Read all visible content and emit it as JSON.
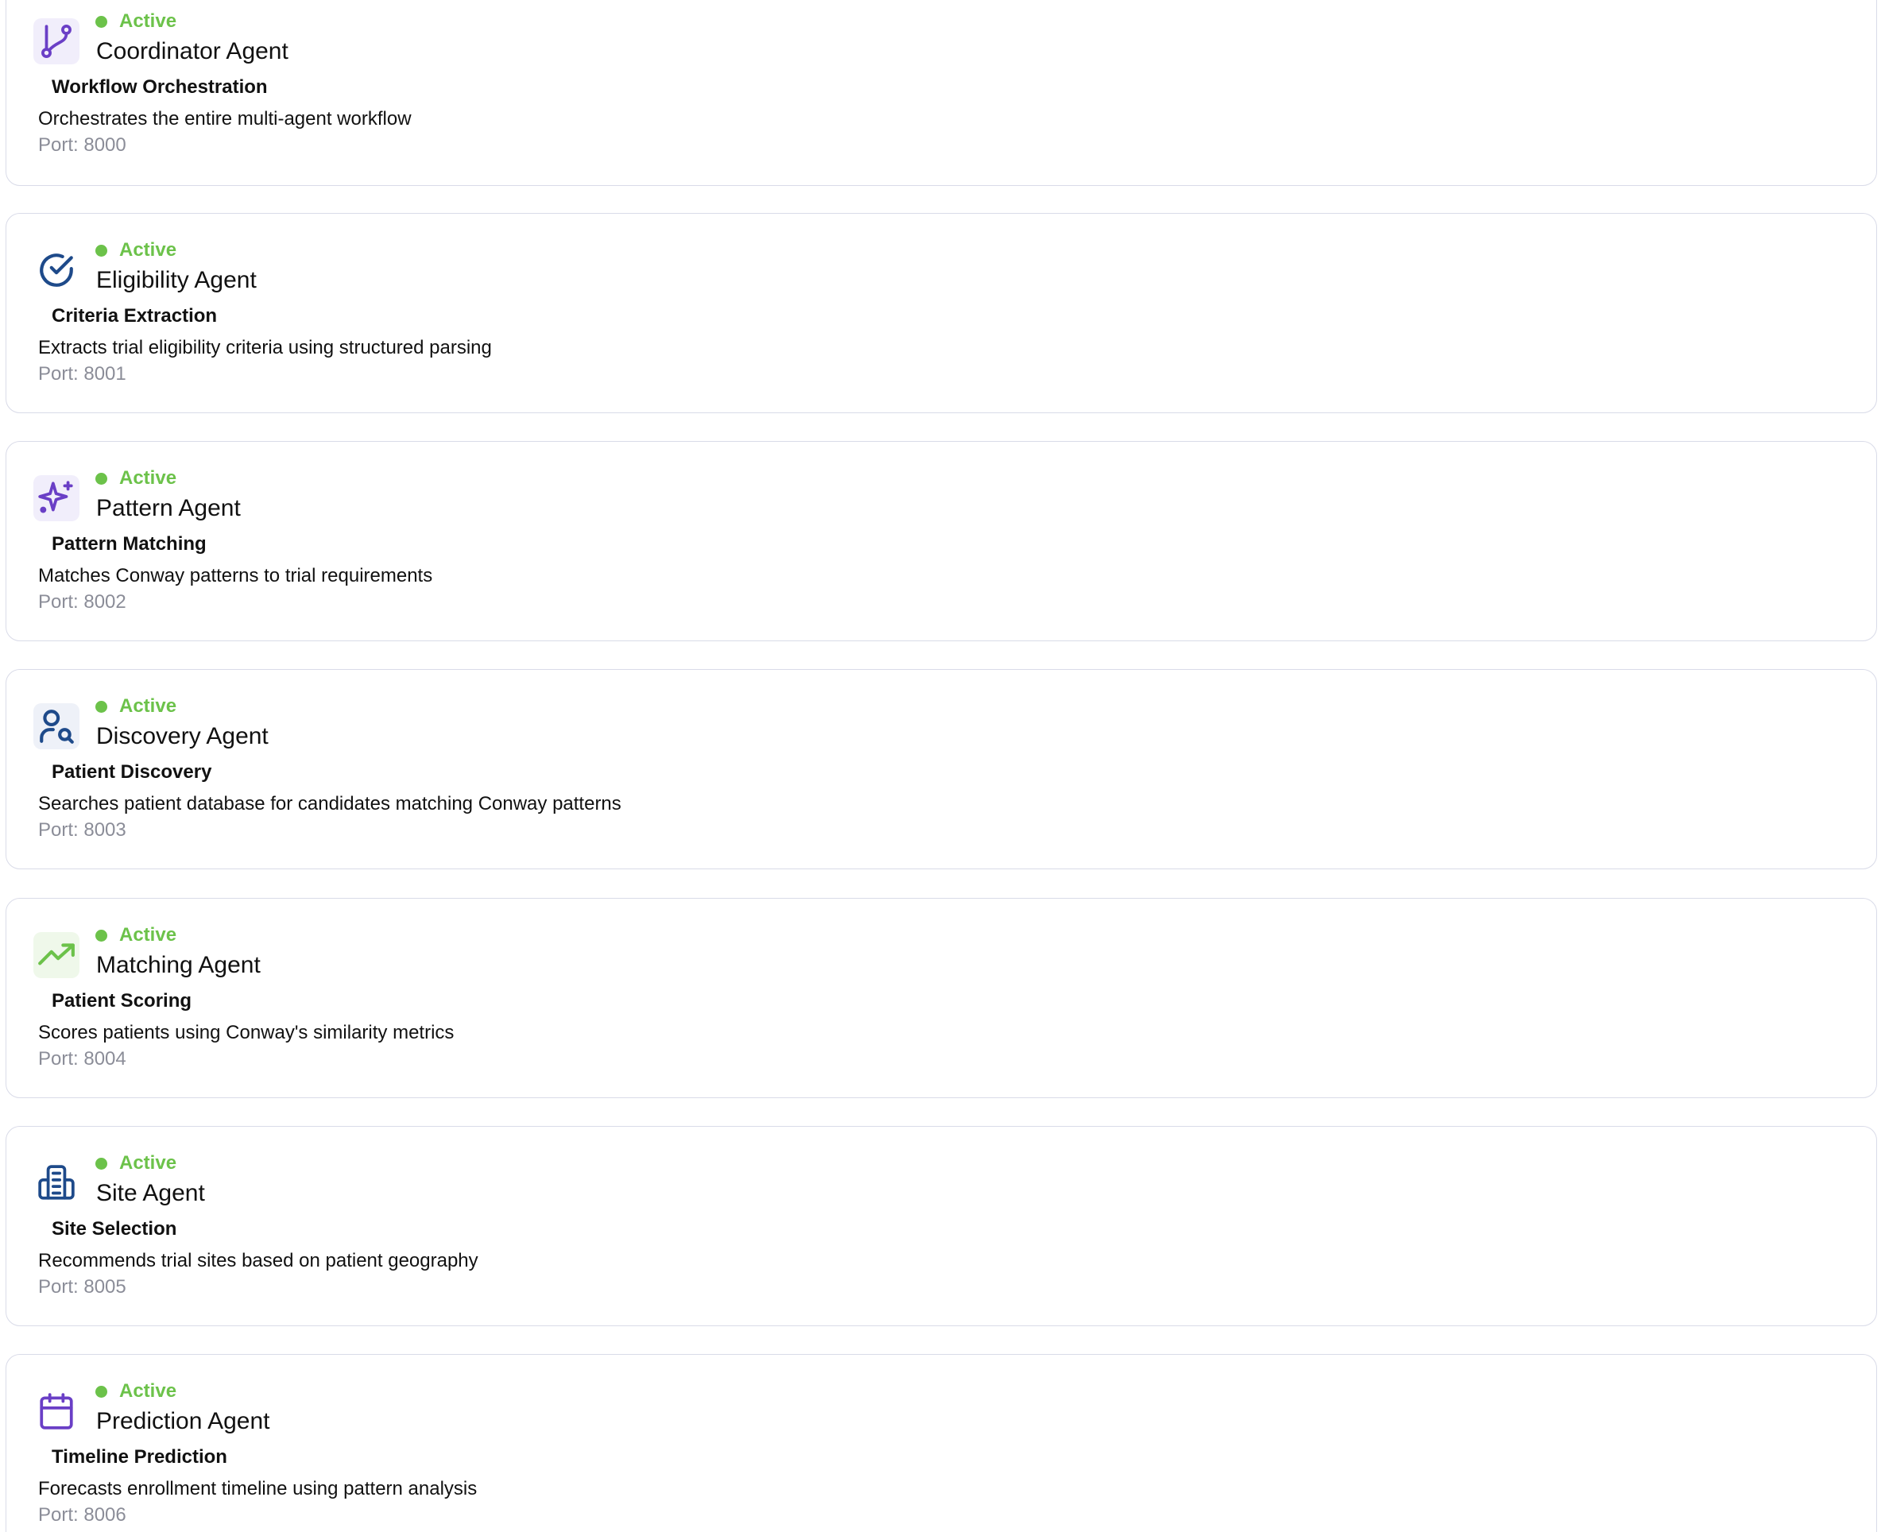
{
  "colors": {
    "status_active": "#6cc24a",
    "card_border": "#d9dbe8",
    "port_text": "#8b8d98",
    "icon_purple": "#6a3fc6",
    "icon_blue": "#1e4a8a",
    "icon_green": "#6cc24a"
  },
  "agents": [
    {
      "status": "Active",
      "name": "Coordinator Agent",
      "role": "Workflow Orchestration",
      "description": "Orchestrates the entire multi-agent workflow",
      "port": "Port: 8000",
      "icon": "git-branch-icon",
      "icon_color": "#6a3fc6",
      "icon_bg": "#f1eefb"
    },
    {
      "status": "Active",
      "name": "Eligibility Agent",
      "role": "Criteria Extraction",
      "description": "Extracts trial eligibility criteria using structured parsing",
      "port": "Port: 8001",
      "icon": "check-circle-icon",
      "icon_color": "#1e4a8a",
      "icon_bg": "#ffffff"
    },
    {
      "status": "Active",
      "name": "Pattern Agent",
      "role": "Pattern Matching",
      "description": "Matches Conway patterns to trial requirements",
      "port": "Port: 8002",
      "icon": "sparkles-icon",
      "icon_color": "#6a3fc6",
      "icon_bg": "#f1eefb"
    },
    {
      "status": "Active",
      "name": "Discovery Agent",
      "role": "Patient Discovery",
      "description": "Searches patient database for candidates matching Conway patterns",
      "port": "Port: 8003",
      "icon": "user-search-icon",
      "icon_color": "#1e4a8a",
      "icon_bg": "#eef1f8"
    },
    {
      "status": "Active",
      "name": "Matching Agent",
      "role": "Patient Scoring",
      "description": "Scores patients using Conway's similarity metrics",
      "port": "Port: 8004",
      "icon": "trending-up-icon",
      "icon_color": "#6cc24a",
      "icon_bg": "#eff8ea"
    },
    {
      "status": "Active",
      "name": "Site Agent",
      "role": "Site Selection",
      "description": "Recommends trial sites based on patient geography",
      "port": "Port: 8005",
      "icon": "building-icon",
      "icon_color": "#1e4a8a",
      "icon_bg": "#ffffff"
    },
    {
      "status": "Active",
      "name": "Prediction Agent",
      "role": "Timeline Prediction",
      "description": "Forecasts enrollment timeline using pattern analysis",
      "port": "Port: 8006",
      "icon": "calendar-icon",
      "icon_color": "#6a3fc6",
      "icon_bg": "#ffffff"
    }
  ]
}
